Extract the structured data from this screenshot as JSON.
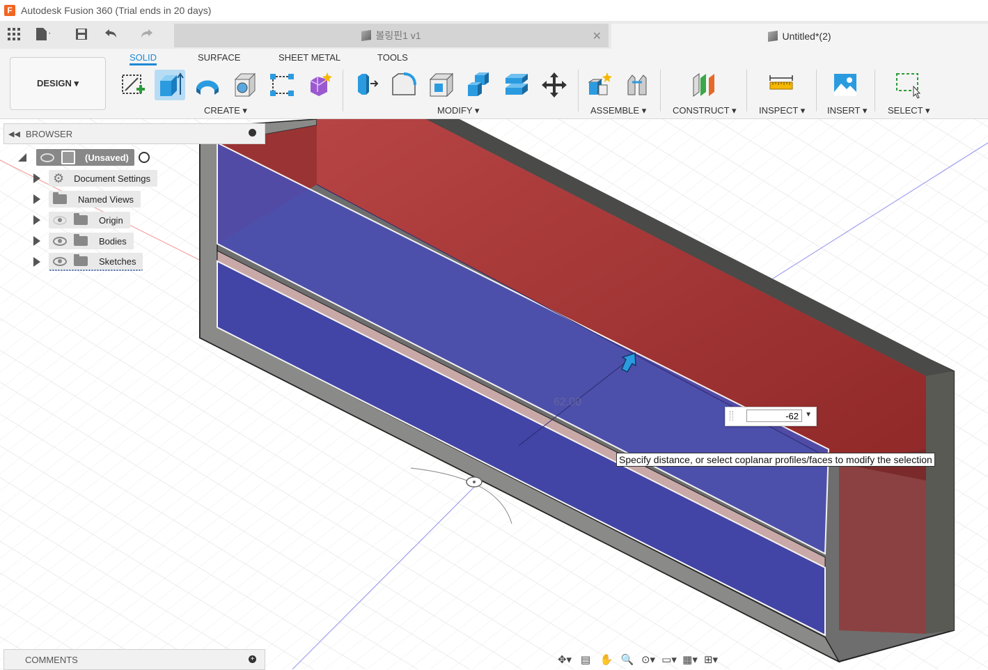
{
  "app": {
    "logo_letter": "F",
    "title": "Autodesk Fusion 360 (Trial ends in 20 days)"
  },
  "quickbar": {
    "icons": [
      "grid-icon",
      "file-icon",
      "save-icon",
      "undo-icon",
      "redo-icon"
    ]
  },
  "tabs": {
    "inactive_label": "볼링핀1 v1",
    "active_label": "Untitled*(2)"
  },
  "ribbon": {
    "workspace": "DESIGN ▾",
    "tabs": [
      "SOLID",
      "SURFACE",
      "SHEET METAL",
      "TOOLS"
    ],
    "active_tab": "SOLID",
    "groups": {
      "create": "CREATE ▾",
      "modify": "MODIFY ▾",
      "assemble": "ASSEMBLE ▾",
      "construct": "CONSTRUCT ▾",
      "inspect": "INSPECT ▾",
      "insert": "INSERT ▾",
      "select": "SELECT ▾"
    }
  },
  "browser": {
    "title": "BROWSER",
    "root": "(Unsaved)",
    "items": [
      {
        "label": "Document Settings"
      },
      {
        "label": "Named Views"
      },
      {
        "label": "Origin"
      },
      {
        "label": "Bodies"
      },
      {
        "label": "Sketches"
      }
    ]
  },
  "viewport": {
    "ghost_dimension": "62.00",
    "input_value": "-62",
    "tooltip": "Specify distance, or select coplanar profiles/faces to modify the selection"
  },
  "comments": {
    "title": "COMMENTS"
  },
  "colors": {
    "accent": "#1e88d5",
    "red_face": "#a33535",
    "blue_face": "#4a4aa8"
  }
}
